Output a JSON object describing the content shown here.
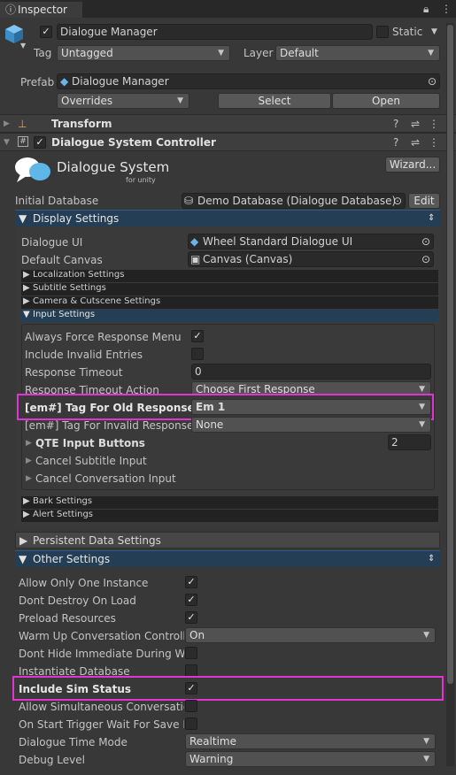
{
  "tab": {
    "title": "Inspector",
    "lock_icon": "lock-icon",
    "menu_icon": "kebab-icon"
  },
  "object": {
    "name": "Dialogue Manager",
    "static_label": "Static",
    "tag_label": "Tag",
    "tag_value": "Untagged",
    "layer_label": "Layer",
    "layer_value": "Default",
    "prefab_label": "Prefab",
    "prefab_value": "Dialogue Manager",
    "overrides": "Overrides",
    "select": "Select",
    "open": "Open"
  },
  "components": {
    "transform": "Transform",
    "controller": "Dialogue System Controller"
  },
  "logo": {
    "title": "Dialogue System",
    "subtitle": "for unity",
    "bubble_text": "...",
    "wizard": "Wizard..."
  },
  "initial_db": {
    "label": "Initial Database",
    "value": "Demo Database (Dialogue Database)",
    "edit": "Edit"
  },
  "display_settings": {
    "title": "Display Settings",
    "dialogue_ui_label": "Dialogue UI",
    "dialogue_ui_value": "Wheel Standard Dialogue UI",
    "canvas_label": "Default Canvas",
    "canvas_value": "Canvas (Canvas)"
  },
  "sub_sections": {
    "localization": "Localization Settings",
    "subtitle": "Subtitle Settings",
    "camera": "Camera & Cutscene Settings",
    "input": "Input Settings",
    "bark": "Bark Settings",
    "alert": "Alert Settings"
  },
  "input_settings": {
    "always_force": "Always Force Response Menu",
    "include_invalid": "Include Invalid Entries",
    "response_timeout": "Response Timeout",
    "response_timeout_value": "0",
    "timeout_action": "Response Timeout Action",
    "timeout_action_value": "Choose First Response",
    "old_responses": "[em#] Tag For Old Responses",
    "old_responses_value": "Em 1",
    "invalid_responses": "[em#] Tag For Invalid Responses",
    "invalid_responses_value": "None",
    "qte": "QTE Input Buttons",
    "qte_value": "2",
    "cancel_subtitle": "Cancel Subtitle Input",
    "cancel_conversation": "Cancel Conversation Input"
  },
  "persistent": {
    "title": "Persistent Data Settings"
  },
  "other_settings": {
    "title": "Other Settings",
    "allow_one": "Allow Only One Instance",
    "dont_destroy": "Dont Destroy On Load",
    "preload": "Preload Resources",
    "warmup": "Warm Up Conversation Controller",
    "warmup_value": "On",
    "dont_hide": "Dont Hide Immediate During Warm",
    "instantiate": "Instantiate Database",
    "sim_status": "Include Sim Status",
    "allow_simultaneous": "Allow Simultaneous Conversations",
    "on_start": "On Start Trigger Wait For Save Data",
    "time_mode": "Dialogue Time Mode",
    "time_mode_value": "Realtime",
    "debug": "Debug Level",
    "debug_value": "Warning"
  },
  "glyphs": {
    "check": "✓",
    "tri_right": "▶",
    "tri_down": "▼",
    "arrow": "▼",
    "help": "?",
    "sliders": "⇌",
    "kebab": "⋮",
    "circle": "⊙",
    "updown": "⇕"
  },
  "colors": {
    "highlight": "#e233d3",
    "blue_header": "#243f55"
  }
}
